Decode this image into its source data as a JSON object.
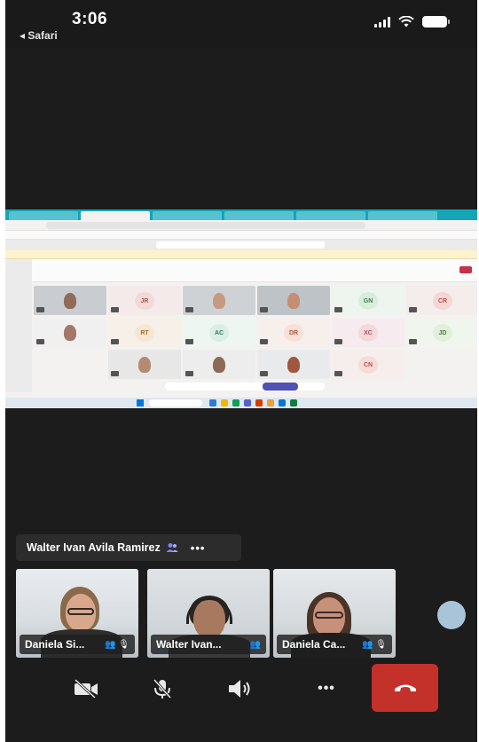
{
  "status_bar": {
    "time": "3:06",
    "back_app": "Safari"
  },
  "speaker": {
    "name": "Walter Ivan Avila Ramirez",
    "more": "•••"
  },
  "participant_tiles": [
    {
      "initials": "JR",
      "color": "#f4d9d9"
    },
    {
      "initials": "GN",
      "color": "#d8eedc"
    },
    {
      "initials": "CR",
      "color": "#f4d6d6"
    },
    {
      "initials": "RT",
      "color": "#f6e7d5"
    },
    {
      "initials": "AC",
      "color": "#dbeee6"
    },
    {
      "initials": "DR",
      "color": "#f6e0d8"
    },
    {
      "initials": "XC",
      "color": "#f4d8de"
    },
    {
      "initials": "JD",
      "color": "#e2efdc"
    },
    {
      "initials": "CN",
      "color": "#f6dcd8"
    }
  ],
  "thumbnails": [
    {
      "name": "Daniela Si...",
      "icons": "👥 🎙"
    },
    {
      "name": "Walter Ivan...",
      "icons": "👥"
    },
    {
      "name": "Daniela Ca...",
      "icons": "👥 🎙"
    }
  ],
  "controls": {
    "camera": "camera-off-icon",
    "mic": "mic-off-icon",
    "speaker": "speaker-icon",
    "more": "•••",
    "end_call": "end-call-icon",
    "end_call_color": "#c4312b"
  }
}
